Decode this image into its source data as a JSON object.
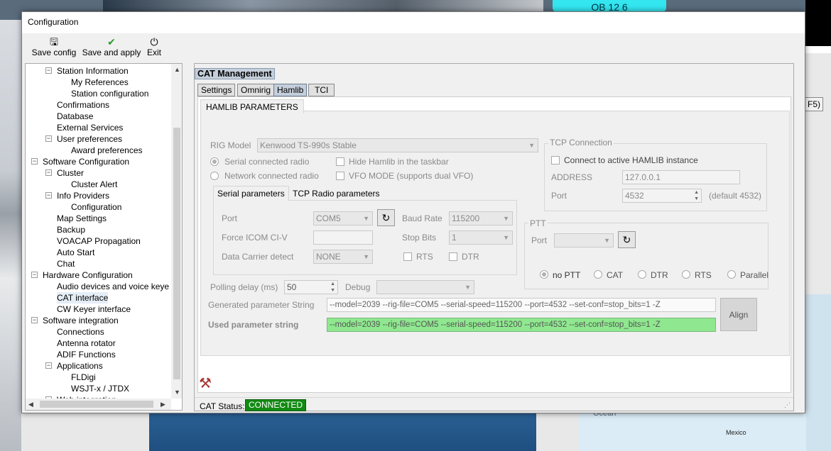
{
  "background": {
    "badge": "OB 12 6",
    "key_hint": "F5)",
    "ocean_label": "Ocean",
    "mexico_label": "Mexico"
  },
  "window": {
    "title": "Configuration"
  },
  "toolbar": {
    "save_config": "Save config",
    "save_apply": "Save and apply",
    "exit": "Exit"
  },
  "tree": {
    "items": [
      "Station Information",
      "My References",
      "Station configuration",
      "Confirmations",
      "Database",
      "External Services",
      "User preferences",
      "Award preferences",
      "Software Configuration",
      "Cluster",
      "Cluster Alert",
      "Info Providers",
      "Configuration",
      "Map Settings",
      "Backup",
      "VOACAP Propagation",
      "Auto Start",
      "Chat",
      "Hardware Configuration",
      "Audio devices and voice keye",
      "CAT interface",
      "CW Keyer interface",
      "Software integration",
      "Connections",
      "Antenna rotator",
      "ADIF Functions",
      "Applications",
      "FLDigi",
      "WSJT-x / JTDX",
      "Web integration"
    ]
  },
  "cat": {
    "header": "CAT Management",
    "tabs": [
      "Settings",
      "Omnirig",
      "Hamlib",
      "TCI"
    ],
    "subtab": "HAMLIB PARAMETERS",
    "rig_model_label": "RIG Model",
    "rig_model_value": "Kenwood TS-990s Stable",
    "serial_radio": "Serial connected radio",
    "network_radio": "Network connected radio",
    "hide_hamlib": "Hide Hamlib in the taskbar",
    "vfo_mode": "VFO MODE (supports dual VFO)",
    "serial_tabs": [
      "Serial parameters",
      "TCP Radio parameters"
    ],
    "port_label": "Port",
    "port_value": "COM5",
    "baud_label": "Baud Rate",
    "baud_value": "115200",
    "icom_label": "Force ICOM CI-V",
    "stopbits_label": "Stop Bits",
    "stopbits_value": "1",
    "dcd_label": "Data Carrier detect",
    "dcd_value": "NONE",
    "rts": "RTS",
    "dtr": "DTR",
    "tcp_title": "TCP Connection",
    "tcp_connect": "Connect to active HAMLIB instance",
    "address_label": "ADDRESS",
    "address_value": "127.0.0.1",
    "tcp_port_label": "Port",
    "tcp_port_value": "4532",
    "tcp_port_default": "(default 4532)",
    "ptt_title": "PTT",
    "ptt_port_label": "Port",
    "ptt_options": [
      "no PTT",
      "CAT",
      "DTR",
      "RTS",
      "Parallel"
    ],
    "polling_label": "Polling delay (ms)",
    "polling_value": "50",
    "debug_label": "Debug",
    "generated_label": "Generated parameter String",
    "generated_value": "--model=2039 --rig-file=COM5 --serial-speed=115200 --port=4532 --set-conf=stop_bits=1 -Z",
    "used_label": "Used parameter string",
    "used_value": "--model=2039 --rig-file=COM5 --serial-speed=115200 --port=4532 --set-conf=stop_bits=1 -Z",
    "align": "Align",
    "status_label": "CAT Status:",
    "status_value": "CONNECTED"
  },
  "colors": {
    "connected": "#138a13",
    "used_param_bg": "#8fe88f",
    "ob_badge": "#33e6f0"
  }
}
